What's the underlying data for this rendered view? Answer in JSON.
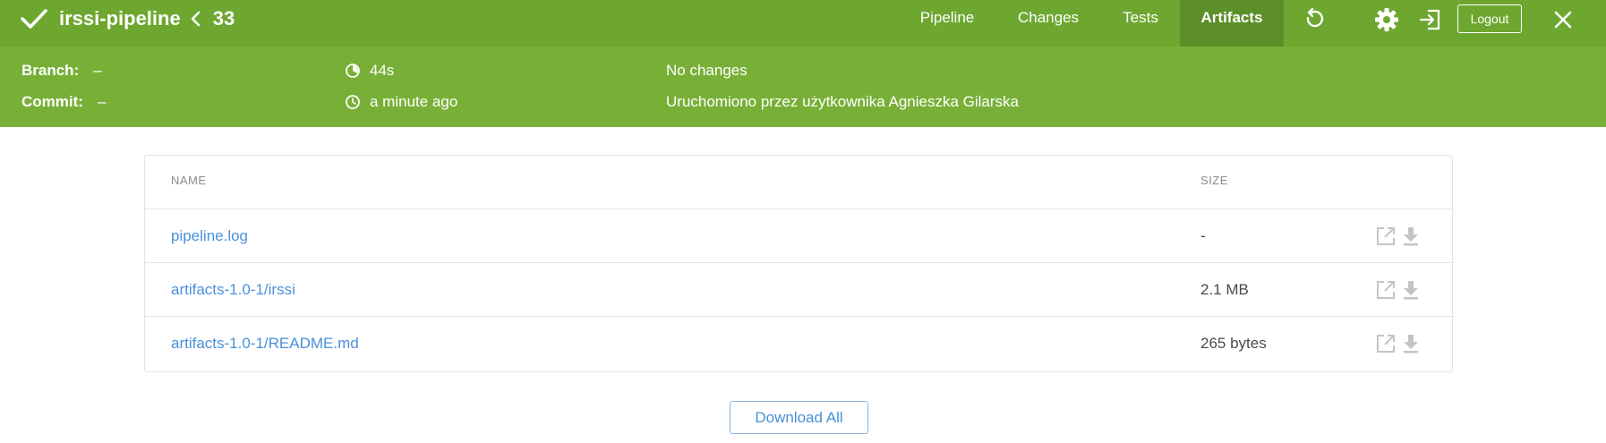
{
  "header": {
    "pipeline_name": "irssi-pipeline",
    "run_number": "33",
    "status": "success",
    "nav": [
      {
        "label": "Pipeline"
      },
      {
        "label": "Changes"
      },
      {
        "label": "Tests"
      },
      {
        "label": "Artifacts",
        "active": true
      }
    ],
    "logout_label": "Logout",
    "icons": [
      "check-icon",
      "chevron-left-icon",
      "rerun-icon",
      "gear-icon",
      "exit-icon",
      "close-icon"
    ]
  },
  "run_info": {
    "branch_label": "Branch:",
    "branch_value": "–",
    "commit_label": "Commit:",
    "commit_value": "–",
    "duration": "44s",
    "time_ago": "a minute ago",
    "changes": "No changes",
    "started_by": "Uruchomiono przez użytkownika Agnieszka Gilarska"
  },
  "artifacts": {
    "columns": {
      "name": "NAME",
      "size": "SIZE"
    },
    "rows": [
      {
        "name": "pipeline.log",
        "size": "-"
      },
      {
        "name": "artifacts-1.0-1/irssi",
        "size": "2.1 MB"
      },
      {
        "name": "artifacts-1.0-1/README.md",
        "size": "265 bytes"
      }
    ],
    "download_all_label": "Download All"
  },
  "colors": {
    "header": "#6da730",
    "subheader": "#78b037",
    "active_tab": "#5c8f28",
    "link": "#4a90d9"
  }
}
